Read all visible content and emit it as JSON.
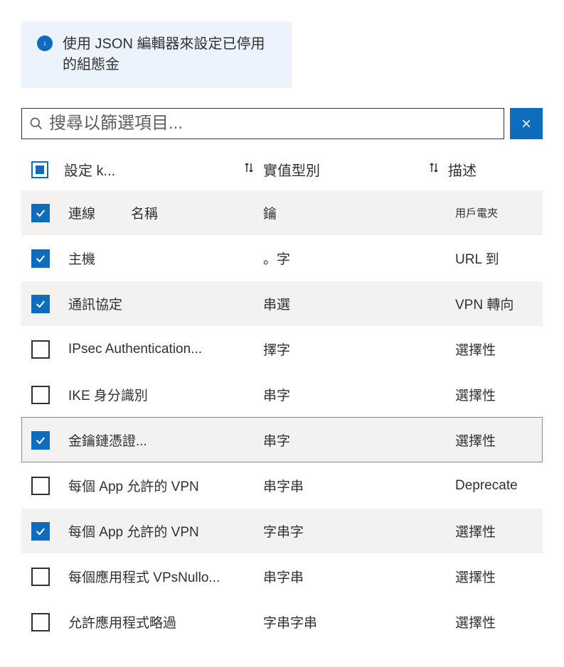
{
  "info_banner": {
    "text": "使用 JSON 編輯器來設定已停用的組態金"
  },
  "search": {
    "placeholder": "搜尋以篩選項目..."
  },
  "table": {
    "headers": {
      "setting": "設定 k...",
      "type": "實值型別",
      "desc": "描述"
    },
    "rows": [
      {
        "checked": true,
        "setting": "連線",
        "extra": "名稱",
        "type": "鑰",
        "desc": "用戶電夾",
        "desc_small": true,
        "alt": true
      },
      {
        "checked": true,
        "setting": "主機",
        "extra": "",
        "type": "。字",
        "desc": "URL 到",
        "desc_small": false,
        "alt": false
      },
      {
        "checked": true,
        "setting": "通訊協定",
        "extra": "",
        "type": "串選",
        "desc": "VPN 轉向",
        "desc_small": false,
        "alt": true
      },
      {
        "checked": false,
        "setting": "IPsec Authentication...",
        "extra": "",
        "type": "擇字",
        "desc": "選擇性",
        "desc_small": false,
        "alt": false
      },
      {
        "checked": false,
        "setting": "IKE 身分識別",
        "extra": "",
        "type": "串字",
        "desc": "選擇性",
        "desc_small": false,
        "alt": false
      },
      {
        "checked": true,
        "setting": "金鑰鏈憑證...",
        "extra": "",
        "type": "串字",
        "desc": "選擇性",
        "desc_small": false,
        "alt": true,
        "highlight": true
      },
      {
        "checked": false,
        "setting": "每個 App 允許的 VPN",
        "extra": "",
        "type": "串字串",
        "desc": "Deprecate",
        "desc_small": false,
        "alt": false
      },
      {
        "checked": true,
        "setting": "每個 App 允許的 VPN",
        "extra": "",
        "type": "字串字",
        "desc": "選擇性",
        "desc_small": false,
        "alt": true
      },
      {
        "checked": false,
        "setting": "每個應用程式 VPsNullo...",
        "extra": "",
        "type": "串字串",
        "desc": "選擇性",
        "desc_small": false,
        "alt": false
      },
      {
        "checked": false,
        "setting": "允許應用程式略過",
        "extra": "",
        "type": "字串字串",
        "desc": "選擇性",
        "desc_small": false,
        "alt": false
      }
    ]
  }
}
